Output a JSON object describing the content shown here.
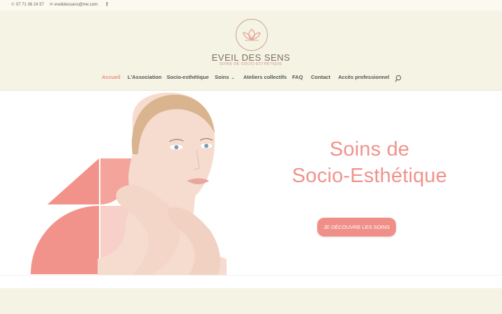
{
  "topbar": {
    "phone": "07 71 08 24 57",
    "email": "eveildessans@me.com",
    "facebook_icon": "facebook-icon"
  },
  "brand": {
    "name": "EVEIL DES SENS",
    "tagline": "SOINS DE SOCIO-ESTHÉTIQUE",
    "logo_icon": "lotus-logo-icon"
  },
  "nav": {
    "items": [
      {
        "label": "Accueil"
      },
      {
        "label": "L'Association"
      },
      {
        "label": "Socio-esthétique"
      },
      {
        "label": "Soins"
      },
      {
        "label": "Ateliers collectifs"
      },
      {
        "label": "FAQ"
      },
      {
        "label": "Contact"
      },
      {
        "label": "Accès professionnel"
      }
    ],
    "active": "Accueil",
    "search_icon": "search-icon"
  },
  "hero": {
    "title_line1": "Soins de",
    "title_line2": "Socio-Esthétique",
    "cta_label": "Je découvre les soins"
  },
  "colors": {
    "accent": "#ef8f88",
    "header_bg": "#f5f3e3",
    "topbar_bg": "#fbfaf0",
    "text": "#555555"
  }
}
